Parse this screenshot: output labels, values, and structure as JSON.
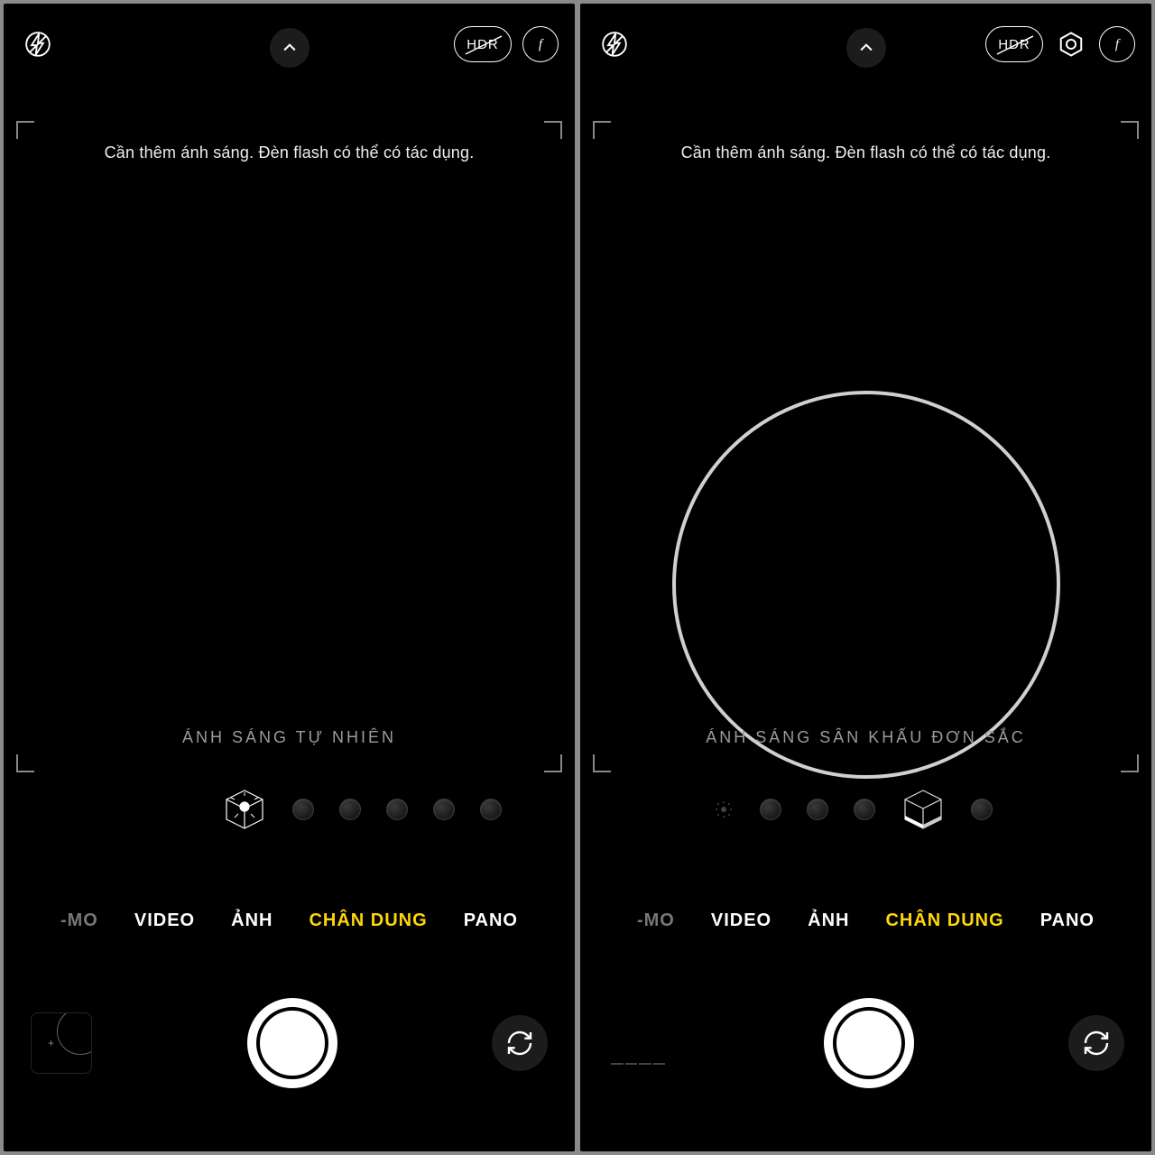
{
  "left": {
    "hint": "Cần thêm ánh sáng. Đèn flash có thể có tác dụng.",
    "lighting_label": "ÁNH SÁNG TỰ NHIÊN",
    "hdr_label": "HDR",
    "modes": {
      "mo": "-MO",
      "video": "VIDEO",
      "anh": "ẢNH",
      "chandung": "CHÂN DUNG",
      "pano": "PANO"
    }
  },
  "right": {
    "hint": "Cần thêm ánh sáng. Đèn flash có thể có tác dụng.",
    "lighting_label": "ÁNH SÁNG SÂN KHẤU ĐƠN SẮC",
    "hdr_label": "HDR",
    "modes": {
      "mo": "-MO",
      "video": "VIDEO",
      "anh": "ẢNH",
      "chandung": "CHÂN DUNG",
      "pano": "PANO"
    }
  }
}
